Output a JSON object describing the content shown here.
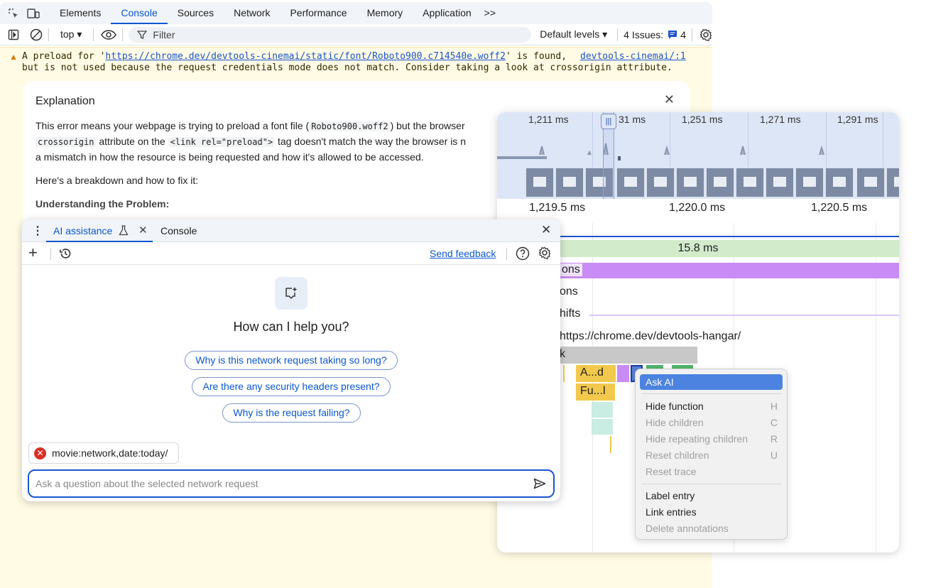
{
  "devtools": {
    "tabs": [
      "Elements",
      "Console",
      "Sources",
      "Network",
      "Performance",
      "Memory",
      "Application"
    ],
    "more_tabs": ">>",
    "active_tab": "Console",
    "toolbar": {
      "context": "top ▾",
      "filter_placeholder": "Filter",
      "levels": "Default levels ▾",
      "issues_label": "4 Issues:",
      "issues_count": "4"
    },
    "warning": {
      "line1_prefix": "A preload for '",
      "url": "https://chrome.dev/devtools-cinemai/static/font/Roboto900.c714540e.woff2",
      "line1_suffix": "' is found,",
      "line2": "but is not used because the request credentials mode does not match. Consider taking a look at crossorigin attribute.",
      "source": "devtools-cinemai/:1"
    },
    "explanation": {
      "title": "Explanation",
      "p1_a": "This error means your webpage is trying to preload a font file (",
      "p1_code": "Roboto900.woff2",
      "p1_b": ") but the browser",
      "p1_code2": "crossorigin",
      "p1_c": " attribute on the ",
      "p1_code3": "<link rel=\"preload\">",
      "p1_d": " tag doesn't match the way the browser is n",
      "p1_e": "a mismatch in how the resource is being requested and how it's allowed to be accessed.",
      "p2": "Here's a breakdown and how to fix it:",
      "p3": "Understanding the Problem:"
    }
  },
  "performance": {
    "overview_ticks": [
      "1,211 ms",
      "31 ms",
      "1,251 ms",
      "1,271 ms",
      "1,291 ms"
    ],
    "ruler_ticks": [
      "1,219.5 ms",
      "1,220.0 ms",
      "1,220.5 ms"
    ],
    "duration_label": "15.8 ms",
    "tracks": [
      "ons",
      "ons",
      "hifts",
      "https://chrome.dev/devtools-hangar/",
      "k"
    ],
    "blocks": [
      "A...d",
      "Fu...l"
    ]
  },
  "context_menu": {
    "ask_ai": "Ask AI",
    "items": [
      {
        "label": "Hide function",
        "shortcut": "H",
        "enabled": true
      },
      {
        "label": "Hide children",
        "shortcut": "C",
        "enabled": false
      },
      {
        "label": "Hide repeating children",
        "shortcut": "R",
        "enabled": false
      },
      {
        "label": "Reset children",
        "shortcut": "U",
        "enabled": false
      },
      {
        "label": "Reset trace",
        "shortcut": "",
        "enabled": false
      }
    ],
    "items2": [
      {
        "label": "Label entry",
        "enabled": true
      },
      {
        "label": "Link entries",
        "enabled": true
      },
      {
        "label": "Delete annotations",
        "enabled": false
      }
    ]
  },
  "ai_panel": {
    "tab_ai": "AI assistance",
    "tab_console": "Console",
    "send_feedback": "Send feedback",
    "heading": "How can I help you?",
    "suggestions": [
      "Why is this network request taking so long?",
      "Are there any security headers present?",
      "Why is the request failing?"
    ],
    "context_chip": "movie:network,date:today/",
    "prompt_placeholder": "Ask a question about the selected network request"
  }
}
